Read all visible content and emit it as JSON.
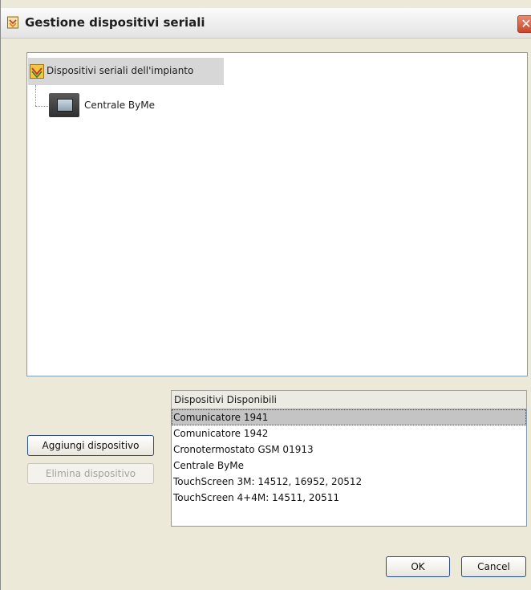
{
  "window": {
    "title": "Gestione dispositivi seriali",
    "close_label": "✕"
  },
  "tree": {
    "root_label": "Dispositivi seriali dell'impianto",
    "children": [
      {
        "label": "Centrale ByMe"
      }
    ]
  },
  "buttons": {
    "add_label": "Aggiungi dispositivo",
    "delete_label": "Elimina dispositivo",
    "ok_label": "OK",
    "cancel_label": "Cancel"
  },
  "available_list": {
    "header": "Dispositivi Disponibili",
    "selected_index": 0,
    "items": [
      "Comunicatore 1941",
      "Comunicatore 1942",
      "Cronotermostato GSM 01913",
      "Centrale ByMe",
      "TouchScreen 3M: 14512, 16952, 20512",
      "TouchScreen 4+4M: 14511, 20511"
    ]
  }
}
